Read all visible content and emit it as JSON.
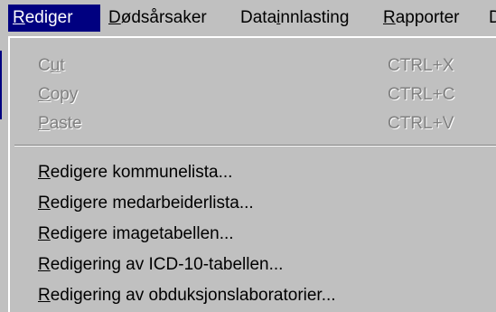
{
  "menubar": {
    "items": [
      {
        "label": "Rediger",
        "accel": "R",
        "rest": "ediger",
        "active": true
      },
      {
        "label": "Dødsårsaker",
        "accel": "D",
        "rest": "ødsårsaker",
        "active": false
      },
      {
        "label": "Datainnlasting",
        "pre": "Data",
        "accel": "i",
        "rest": "nnlasting",
        "active": false
      },
      {
        "label": "Rapporter",
        "accel": "R",
        "rest": "apporter",
        "active": false
      },
      {
        "label": "D",
        "accel": "",
        "rest": "D",
        "active": false
      }
    ]
  },
  "dropdown": {
    "edit_items": [
      {
        "pre": "C",
        "accel": "u",
        "rest": "t",
        "shortcut": "CTRL+X",
        "enabled": false
      },
      {
        "pre": "",
        "accel": "C",
        "rest": "opy",
        "shortcut": "CTRL+C",
        "enabled": false
      },
      {
        "pre": "",
        "accel": "P",
        "rest": "aste",
        "shortcut": "CTRL+V",
        "enabled": false
      }
    ],
    "items": [
      {
        "accel": "R",
        "rest": "edigere kommunelista..."
      },
      {
        "accel": "R",
        "rest": "edigere medarbeiderlista..."
      },
      {
        "accel": "R",
        "rest": "edigere imagetabellen..."
      },
      {
        "accel": "R",
        "rest": "edigering av ICD-10-tabellen..."
      },
      {
        "accel": "R",
        "rest": "edigering av obduksjonslaboratorier..."
      }
    ]
  },
  "colors": {
    "face": "#c0c0c0",
    "highlight": "#000080",
    "disabled": "#808080"
  }
}
